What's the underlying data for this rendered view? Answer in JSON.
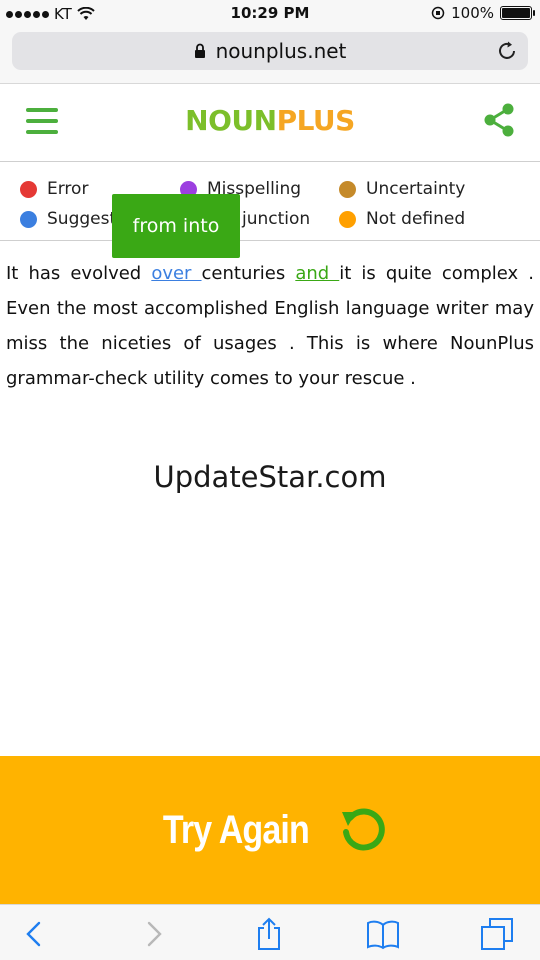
{
  "status_bar": {
    "carrier": "KT",
    "time": "10:29 PM",
    "battery": "100%"
  },
  "browser": {
    "url": "nounplus.net"
  },
  "header": {
    "logo_part1": "NOUN",
    "logo_part2": "PLUS"
  },
  "legend": {
    "items": [
      {
        "label": "Error",
        "color": "#e53935"
      },
      {
        "label": "Misspelling",
        "color": "#9c3fe0"
      },
      {
        "label": "Uncertainty",
        "color": "#c58a2a"
      },
      {
        "label": "Suggest",
        "color": "#3b7fe0"
      },
      {
        "label": "junction",
        "color": "#3aa815"
      },
      {
        "label": "Not defined",
        "color": "#ffa000"
      }
    ]
  },
  "tooltip": {
    "text": "from into"
  },
  "paragraph": {
    "p1": "It has evolved ",
    "w1": "over ",
    "p2": "centuries ",
    "w2": "and ",
    "p3": "it is quite complex . Even the most accomplished English language writer may miss the niceties of usages . This is where NounPlus grammar-check utility comes to your rescue ."
  },
  "watermark": "UpdateStar.com",
  "try_again": {
    "label": "Try Again",
    "color": "#ffb300"
  }
}
